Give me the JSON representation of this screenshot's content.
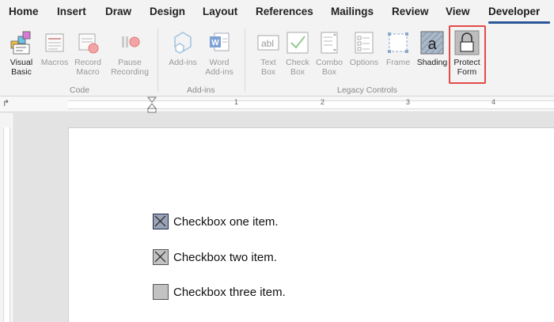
{
  "tabs": [
    {
      "label": "Home"
    },
    {
      "label": "Insert"
    },
    {
      "label": "Draw"
    },
    {
      "label": "Design"
    },
    {
      "label": "Layout"
    },
    {
      "label": "References"
    },
    {
      "label": "Mailings"
    },
    {
      "label": "Review"
    },
    {
      "label": "View"
    },
    {
      "label": "Developer",
      "active": true
    }
  ],
  "ribbon": {
    "code": {
      "group_label": "Code",
      "visual_basic": "Visual\nBasic",
      "macros": "Macros",
      "record_macro": "Record\nMacro",
      "pause_recording": "Pause\nRecording"
    },
    "addins": {
      "group_label": "Add-ins",
      "add_ins": "Add-ins",
      "word_add_ins": "Word\nAdd-ins"
    },
    "legacy": {
      "group_label": "Legacy Controls",
      "text_box": "Text\nBox",
      "check_box": "Check\nBox",
      "combo_box": "Combo\nBox",
      "options": "Options",
      "frame": "Frame",
      "shading": "Shading",
      "protect_form": "Protect\nForm"
    }
  },
  "ruler": {
    "numbers": [
      "1",
      "2",
      "3",
      "4"
    ]
  },
  "document": {
    "checkboxes": [
      {
        "label": "Checkbox one item.",
        "state": "checked-selected"
      },
      {
        "label": "Checkbox two item.",
        "state": "checked"
      },
      {
        "label": "Checkbox three item.",
        "state": "unchecked"
      }
    ]
  },
  "colors": {
    "accent_underline": "#2b5797",
    "highlight_box": "#e34b4b"
  }
}
